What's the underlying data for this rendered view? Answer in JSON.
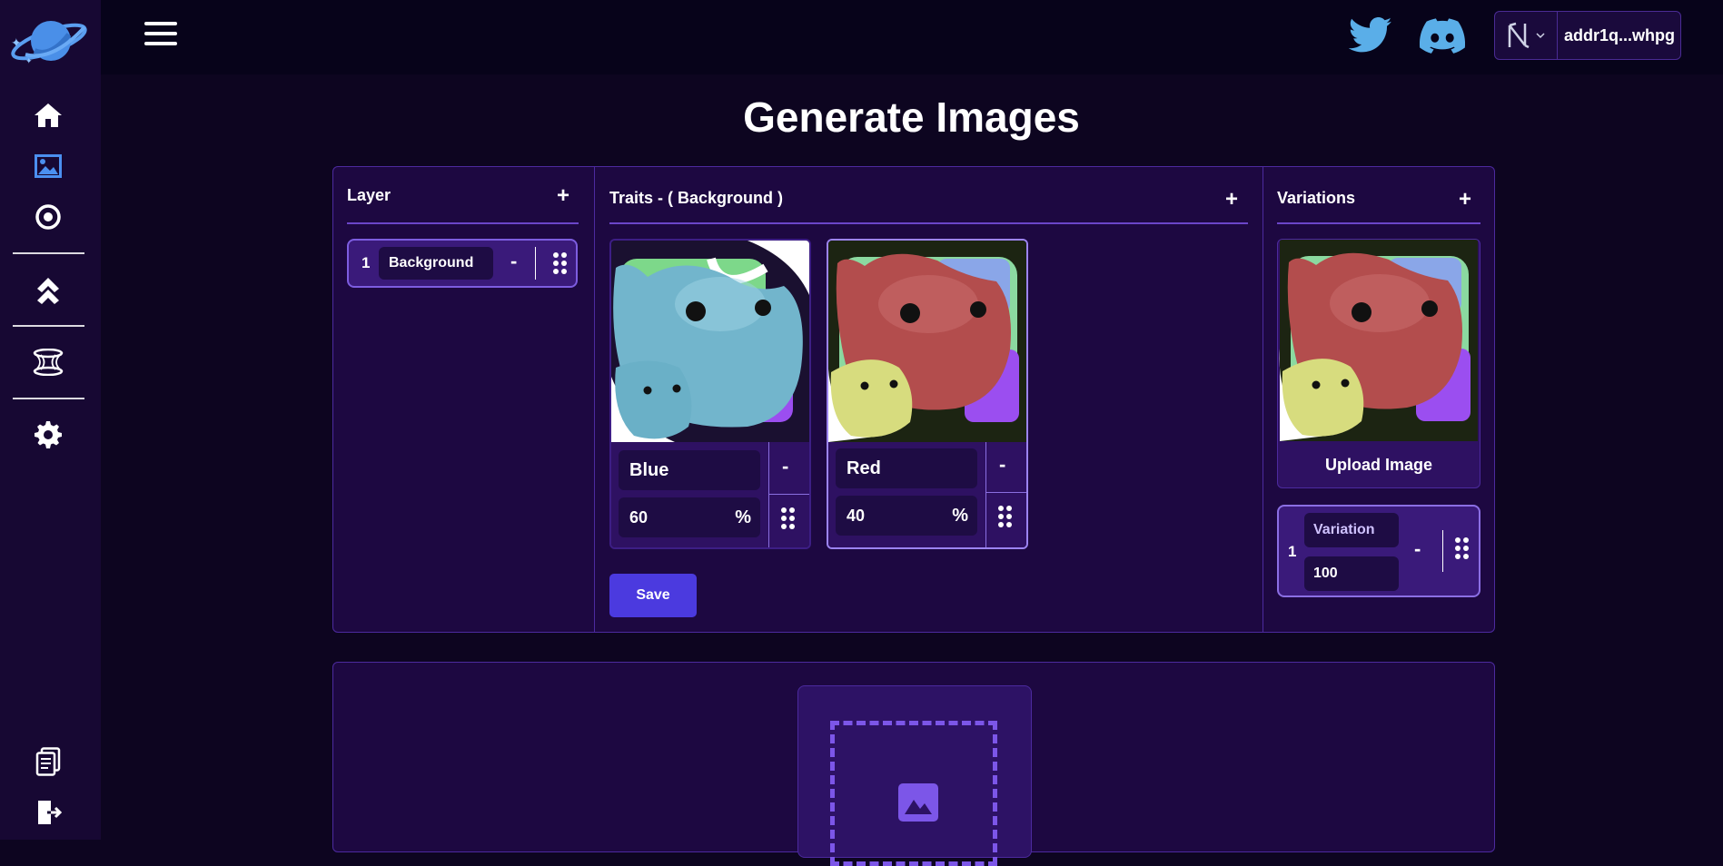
{
  "header": {
    "wallet_address": "addr1q...whpg"
  },
  "page": {
    "title": "Generate Images"
  },
  "layer_panel": {
    "title": "Layer",
    "add_label": "+",
    "layers": [
      {
        "index": "1",
        "name": "Background",
        "remove_label": "-"
      }
    ]
  },
  "traits_panel": {
    "title": "Traits - ( Background )",
    "add_label": "+",
    "traits": [
      {
        "name": "Blue",
        "percent": "60",
        "percent_sign": "%",
        "remove_label": "-",
        "color": "#72b5cc"
      },
      {
        "name": "Red",
        "percent": "40",
        "percent_sign": "%",
        "remove_label": "-",
        "color": "#b34d4d"
      }
    ],
    "save_label": "Save"
  },
  "variations_panel": {
    "title": "Variations",
    "add_label": "+",
    "upload_label": "Upload Image",
    "variations": [
      {
        "index": "1",
        "name": "Variation",
        "value": "100",
        "remove_label": "-"
      }
    ]
  },
  "sidebar": {
    "items": [
      "home-icon",
      "image-icon",
      "target-icon",
      "chevrons-up-icon",
      "wormhole-icon",
      "gear-icon",
      "document-icon",
      "logout-icon"
    ]
  },
  "colors": {
    "accent": "#4b3adf",
    "panel": "#1d0841",
    "border": "#4c2a9e"
  }
}
